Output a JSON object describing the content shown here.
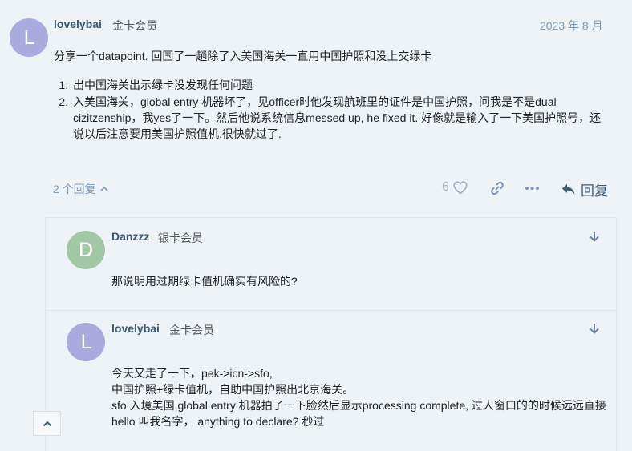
{
  "colors": {
    "avatar_l": "#a9abdf",
    "avatar_d": "#a2c7a4",
    "link_blue": "#7a9ab8",
    "username": "#3a5a78",
    "background": "#eef3f8"
  },
  "main_post": {
    "avatar_letter": "L",
    "username": "lovelybai",
    "user_title": "金卡会员",
    "date": "2023 年 8 月",
    "intro": "分享一个datapoint. 回国了一趟除了入美国海关一直用中国护照和没上交绿卡",
    "list": [
      "出中国海关出示绿卡没发现任何问题",
      "入美国海关，global entry 机器坏了，见officer时他发现航班里的证件是中国护照，问我是不是dual cizitzenship，我yes了一下。然后他说系统信息messed up, he fixed it. 好像就是输入了一下美国护照号，还说以后注意要用美国护照值机.很快就过了."
    ],
    "replies_count_label": "2 个回复",
    "like_count": "6",
    "reply_label": "回复",
    "icons": [
      "chevron-up-icon",
      "heart-icon",
      "link-icon",
      "more-icon",
      "reply-icon"
    ]
  },
  "replies": [
    {
      "avatar_letter": "D",
      "username": "Danzzz",
      "user_title": "银卡会员",
      "lines": [
        "那说明用过期绿卡值机确实有风险的?"
      ]
    },
    {
      "avatar_letter": "L",
      "username": "lovelybai",
      "user_title": "金卡会员",
      "lines": [
        "今天又走了一下，pek->icn->sfo,",
        "中国护照+绿卡值机，自助中国护照出北京海关。",
        "sfo 入境美国 global entry 机器拍了一下脸然后显示processing complete, 过人窗口的的时候远远直接hello 叫我名字， anything to declare? 秒过"
      ]
    }
  ]
}
